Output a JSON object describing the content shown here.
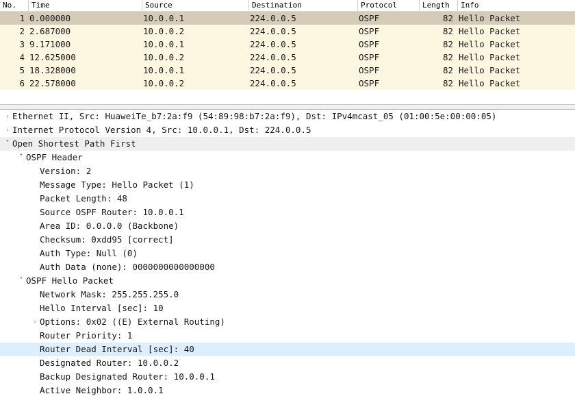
{
  "packet_list": {
    "columns": [
      {
        "key": "no",
        "label": "No."
      },
      {
        "key": "time",
        "label": "Time"
      },
      {
        "key": "src",
        "label": "Source"
      },
      {
        "key": "dst",
        "label": "Destination"
      },
      {
        "key": "proto",
        "label": "Protocol"
      },
      {
        "key": "len",
        "label": "Length"
      },
      {
        "key": "info",
        "label": "Info"
      }
    ],
    "rows": [
      {
        "no": "1",
        "time": "0.000000",
        "src": "10.0.0.1",
        "dst": "224.0.0.5",
        "proto": "OSPF",
        "len": "82",
        "info": "Hello Packet",
        "selected": true
      },
      {
        "no": "2",
        "time": "2.687000",
        "src": "10.0.0.2",
        "dst": "224.0.0.5",
        "proto": "OSPF",
        "len": "82",
        "info": "Hello Packet",
        "selected": false
      },
      {
        "no": "3",
        "time": "9.171000",
        "src": "10.0.0.1",
        "dst": "224.0.0.5",
        "proto": "OSPF",
        "len": "82",
        "info": "Hello Packet",
        "selected": false
      },
      {
        "no": "4",
        "time": "12.625000",
        "src": "10.0.0.2",
        "dst": "224.0.0.5",
        "proto": "OSPF",
        "len": "82",
        "info": "Hello Packet",
        "selected": false
      },
      {
        "no": "5",
        "time": "18.328000",
        "src": "10.0.0.1",
        "dst": "224.0.0.5",
        "proto": "OSPF",
        "len": "82",
        "info": "Hello Packet",
        "selected": false
      },
      {
        "no": "6",
        "time": "22.578000",
        "src": "10.0.0.2",
        "dst": "224.0.0.5",
        "proto": "OSPF",
        "len": "82",
        "info": "Hello Packet",
        "selected": false
      }
    ],
    "colors": {
      "row_background": "#fdf6e1",
      "selected_row_background": "#d4ccb8",
      "header_background": "#ffffff"
    }
  },
  "packet_detail": {
    "rows": [
      {
        "indent": 0,
        "twisty": "collapsed",
        "icon": "chevron-right-icon",
        "name": "detail-ethernet-ii",
        "text": "Ethernet II, Src: HuaweiTe_b7:2a:f9 (54:89:98:b7:2a:f9), Dst: IPv4mcast_05 (01:00:5e:00:00:05)",
        "highlight": "none"
      },
      {
        "indent": 0,
        "twisty": "collapsed",
        "icon": "chevron-right-icon",
        "name": "detail-ipv4",
        "text": "Internet Protocol Version 4, Src: 10.0.0.1, Dst: 224.0.0.5",
        "highlight": "none"
      },
      {
        "indent": 0,
        "twisty": "expanded",
        "icon": "chevron-down-icon",
        "name": "detail-ospf",
        "text": "Open Shortest Path First",
        "highlight": "grey"
      },
      {
        "indent": 1,
        "twisty": "expanded",
        "icon": "chevron-down-icon",
        "name": "detail-ospf-header",
        "text": "OSPF Header",
        "highlight": "none"
      },
      {
        "indent": 2,
        "twisty": "blank",
        "icon": "none",
        "name": "detail-version",
        "text": "Version: 2",
        "highlight": "none"
      },
      {
        "indent": 2,
        "twisty": "blank",
        "icon": "none",
        "name": "detail-message-type",
        "text": "Message Type: Hello Packet (1)",
        "highlight": "none"
      },
      {
        "indent": 2,
        "twisty": "blank",
        "icon": "none",
        "name": "detail-packet-length",
        "text": "Packet Length: 48",
        "highlight": "none"
      },
      {
        "indent": 2,
        "twisty": "blank",
        "icon": "none",
        "name": "detail-source-ospf-router",
        "text": "Source OSPF Router: 10.0.0.1",
        "highlight": "none"
      },
      {
        "indent": 2,
        "twisty": "blank",
        "icon": "none",
        "name": "detail-area-id",
        "text": "Area ID: 0.0.0.0 (Backbone)",
        "highlight": "none"
      },
      {
        "indent": 2,
        "twisty": "blank",
        "icon": "none",
        "name": "detail-checksum",
        "text": "Checksum: 0xdd95 [correct]",
        "highlight": "none"
      },
      {
        "indent": 2,
        "twisty": "blank",
        "icon": "none",
        "name": "detail-auth-type",
        "text": "Auth Type: Null (0)",
        "highlight": "none"
      },
      {
        "indent": 2,
        "twisty": "blank",
        "icon": "none",
        "name": "detail-auth-data",
        "text": "Auth Data (none): 0000000000000000",
        "highlight": "none"
      },
      {
        "indent": 1,
        "twisty": "expanded",
        "icon": "chevron-down-icon",
        "name": "detail-ospf-hello-packet",
        "text": "OSPF Hello Packet",
        "highlight": "none"
      },
      {
        "indent": 2,
        "twisty": "blank",
        "icon": "none",
        "name": "detail-network-mask",
        "text": "Network Mask: 255.255.255.0",
        "highlight": "none"
      },
      {
        "indent": 2,
        "twisty": "blank",
        "icon": "none",
        "name": "detail-hello-interval",
        "text": "Hello Interval [sec]: 10",
        "highlight": "none"
      },
      {
        "indent": 2,
        "twisty": "collapsed",
        "icon": "chevron-right-icon",
        "name": "detail-options",
        "text": "Options: 0x02 ((E) External Routing)",
        "highlight": "none"
      },
      {
        "indent": 2,
        "twisty": "blank",
        "icon": "none",
        "name": "detail-router-priority",
        "text": "Router Priority: 1",
        "highlight": "none"
      },
      {
        "indent": 2,
        "twisty": "blank",
        "icon": "none",
        "name": "detail-router-dead-interval",
        "text": "Router Dead Interval [sec]: 40",
        "highlight": "blue"
      },
      {
        "indent": 2,
        "twisty": "blank",
        "icon": "none",
        "name": "detail-designated-router",
        "text": "Designated Router: 10.0.0.2",
        "highlight": "none"
      },
      {
        "indent": 2,
        "twisty": "blank",
        "icon": "none",
        "name": "detail-backup-designated-router",
        "text": "Backup Designated Router: 10.0.0.1",
        "highlight": "none"
      },
      {
        "indent": 2,
        "twisty": "blank",
        "icon": "none",
        "name": "detail-active-neighbor",
        "text": "Active Neighbor: 1.0.0.1",
        "highlight": "none"
      }
    ],
    "colors": {
      "selected_highlight": "#ddeeff",
      "section_highlight": "#efefef"
    }
  },
  "glyphs": {
    "chevron_right": "›",
    "chevron_down": "ˇ"
  }
}
